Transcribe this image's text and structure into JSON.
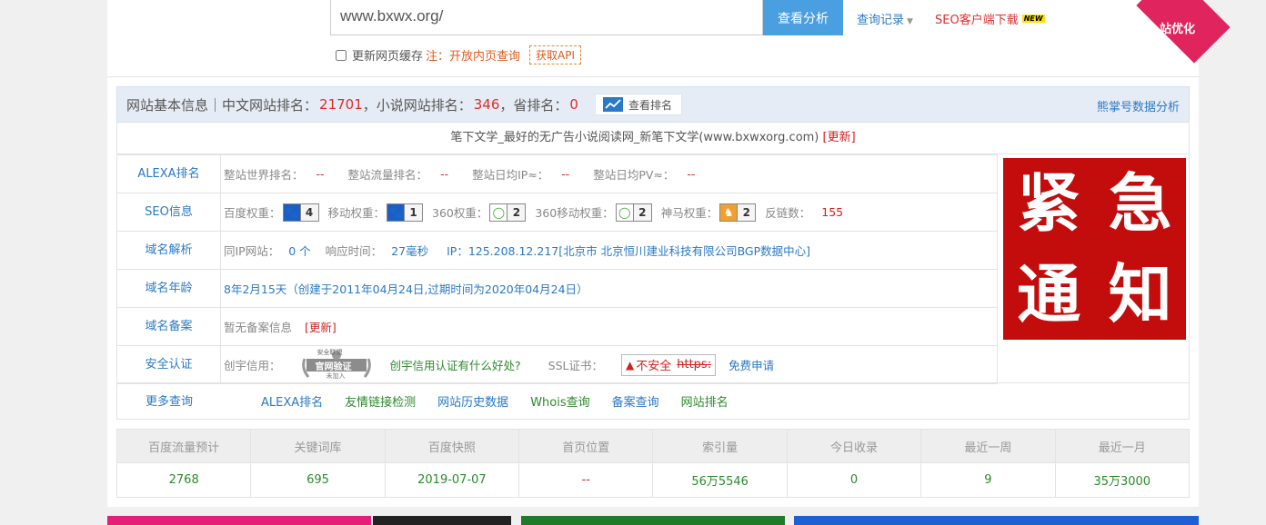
{
  "search": {
    "value": "www.bxwx.org/",
    "button": "查看分析",
    "history": "查询记录",
    "client": "SEO客户端下载",
    "new_badge": "NEW",
    "ribbon": "站优化"
  },
  "options": {
    "refresh_label": "更新网页缓存",
    "note": "注：开放内页查询",
    "api": "获取API"
  },
  "header": {
    "title": "网站基本信息",
    "cn_rank_label": "｜中文网站排名：",
    "cn_rank": "21701",
    "novel_rank_label": "，小说网站排名：",
    "novel_rank": "346",
    "prov_rank_label": "，省排名：",
    "prov_rank": "0",
    "view_rank": "查看排名",
    "bear": "熊掌号数据分析"
  },
  "site": {
    "title": "笔下文学_最好的无广告小说阅读网_新笔下文学(www.bxwxorg.com)",
    "update": "[更新]"
  },
  "alexa": {
    "label": "ALEXA排名",
    "world_label": "整站世界排名：",
    "world": "--",
    "flow_label": "整站流量排名：",
    "flow": "--",
    "ip_label": "整站日均IP≈：",
    "ip": "--",
    "pv_label": "整站日均PV≈：",
    "pv": "--"
  },
  "seo": {
    "label": "SEO信息",
    "baidu_label": "百度权重：",
    "baidu": "4",
    "mobile_label": "移动权重：",
    "mobile": "1",
    "s360_label": "360权重：",
    "s360": "2",
    "s360m_label": "360移动权重：",
    "s360m": "2",
    "shenma_label": "神马权重：",
    "shenma": "2",
    "backlinks_label": "反链数：",
    "backlinks": "155"
  },
  "domain": {
    "label": "域名解析",
    "sameip_label": "同IP网站：",
    "sameip": "0 个",
    "resp_label": "响应时间：",
    "resp": "27毫秒",
    "ip_text": "IP：125.208.12.217[北京市 北京恒川建业科技有限公司BGP数据中心]"
  },
  "age": {
    "label": "域名年龄",
    "text": "8年2月15天（创建于2011年04月24日,过期时间为2020年04月24日）"
  },
  "beian": {
    "label": "域名备案",
    "text": "暂无备案信息",
    "update": "[更新]"
  },
  "security": {
    "label": "安全认证",
    "chuangyu_label": "创宇信用：",
    "seal_top": "安全联盟",
    "seal_mid": "官网验证",
    "seal_bot": "未加入",
    "chuangyu_link": "创宇信用认证有什么好处?",
    "ssl_label": "SSL证书：",
    "insecure": "不安全",
    "https": "https:",
    "free": "免费申请"
  },
  "more": {
    "label": "更多查询",
    "links": [
      "ALEXA排名",
      "友情链接检测",
      "网站历史数据",
      "Whois查询",
      "备案查询",
      "网站排名"
    ]
  },
  "notice": {
    "chars": [
      "紧",
      "急",
      "通",
      "知"
    ]
  },
  "stats": {
    "headers": [
      "百度流量预计",
      "关键词库",
      "百度快照",
      "首页位置",
      "索引量",
      "今日收录",
      "最近一周",
      "最近一月"
    ],
    "values": [
      "2768",
      "695",
      "2019-07-07",
      "--",
      "56万5546",
      "0",
      "9",
      "35万3000"
    ]
  },
  "colors": {
    "accent": "#4a9fe0",
    "link": "#2a79c4",
    "red": "#e02b2b",
    "green": "#2c8a2c",
    "notice_bg": "#c30d0d"
  }
}
